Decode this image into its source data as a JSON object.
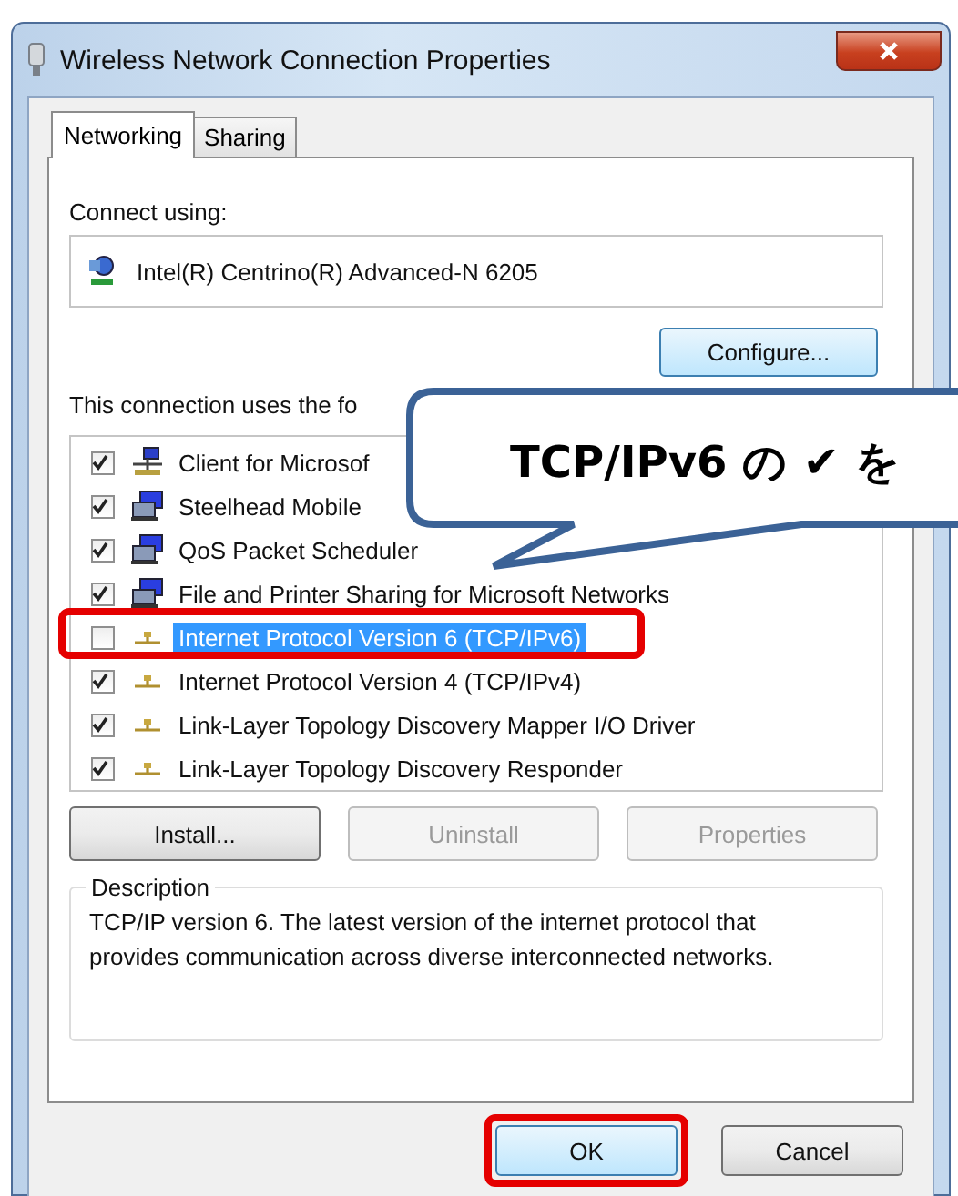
{
  "window": {
    "title": "Wireless Network Connection Properties"
  },
  "tabs": [
    {
      "label": "Networking",
      "selected": true
    },
    {
      "label": "Sharing",
      "selected": false
    }
  ],
  "connect_using": {
    "label": "Connect using:",
    "adapter": "Intel(R) Centrino(R) Advanced-N 6205",
    "button": "Configure..."
  },
  "items_label": "This connection uses the fo",
  "items": [
    {
      "kind": "client",
      "label": "Client for Microsof",
      "checked": true,
      "selected": false,
      "highlighted": false
    },
    {
      "kind": "service",
      "label": "Steelhead Mobile",
      "checked": true,
      "selected": false,
      "highlighted": false
    },
    {
      "kind": "service",
      "label": "QoS Packet Scheduler",
      "checked": true,
      "selected": false,
      "highlighted": false
    },
    {
      "kind": "service",
      "label": "File and Printer Sharing for Microsoft Networks",
      "checked": true,
      "selected": false,
      "highlighted": false
    },
    {
      "kind": "protocol",
      "label": "Internet Protocol Version 6 (TCP/IPv6)",
      "checked": false,
      "selected": true,
      "highlighted": true
    },
    {
      "kind": "protocol",
      "label": "Internet Protocol Version 4 (TCP/IPv4)",
      "checked": true,
      "selected": false,
      "highlighted": false
    },
    {
      "kind": "protocol",
      "label": "Link-Layer Topology Discovery Mapper I/O Driver",
      "checked": true,
      "selected": false,
      "highlighted": false
    },
    {
      "kind": "protocol",
      "label": "Link-Layer Topology Discovery Responder",
      "checked": true,
      "selected": false,
      "highlighted": false
    }
  ],
  "item_buttons": [
    {
      "label": "Install...",
      "disabled": false
    },
    {
      "label": "Uninstall",
      "disabled": true
    },
    {
      "label": "Properties",
      "disabled": true
    }
  ],
  "description": {
    "title": "Description",
    "text": "TCP/IP version 6. The latest version of the internet protocol that provides communication across diverse interconnected networks."
  },
  "footer_buttons": [
    {
      "label": "OK",
      "highlighted": true
    },
    {
      "label": "Cancel",
      "highlighted": false
    }
  ],
  "callout": {
    "text": "TCP/IPv6 の ✔ を"
  }
}
